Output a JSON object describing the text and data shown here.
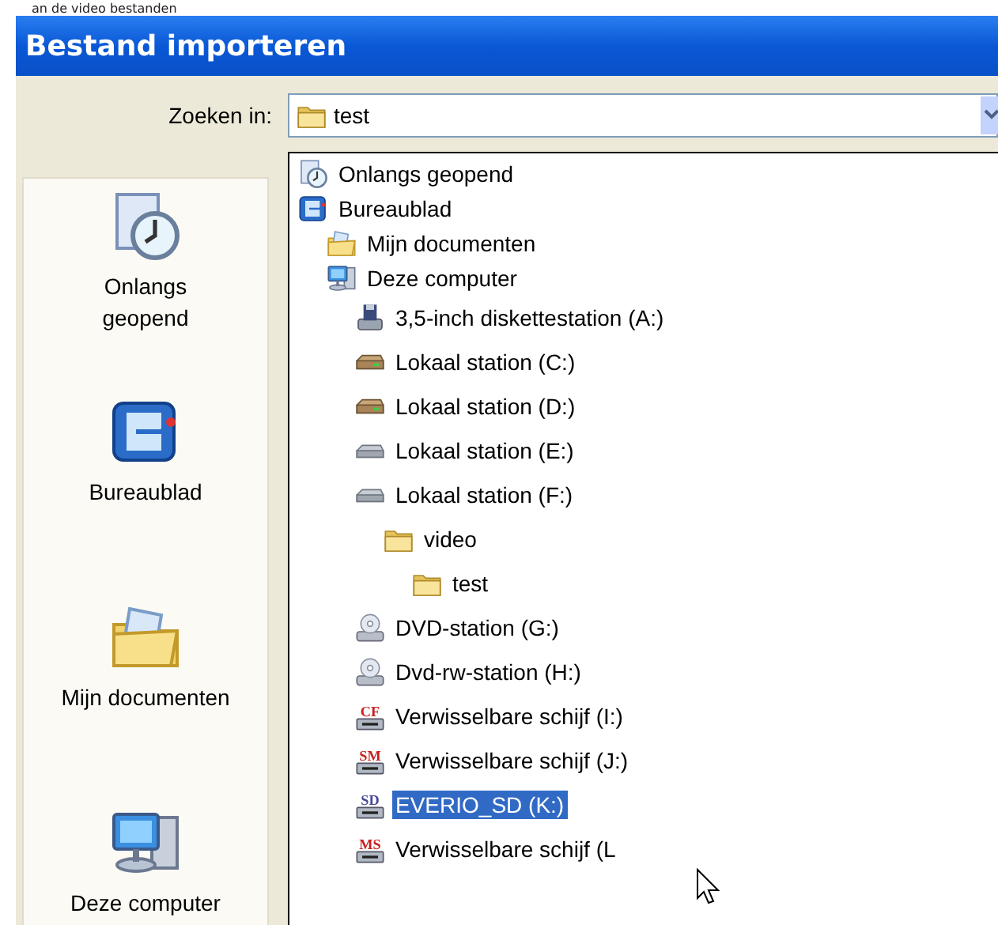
{
  "caption": "an de video bestanden",
  "window": {
    "title": "Bestand importeren"
  },
  "look_in": {
    "label": "Zoeken in:",
    "value": "test"
  },
  "places": [
    {
      "kind": "recent",
      "label": "Onlangs geopend"
    },
    {
      "kind": "desktop",
      "label": "Bureaublad"
    },
    {
      "kind": "documents",
      "label": "Mijn documenten"
    },
    {
      "kind": "computer",
      "label": "Deze computer"
    }
  ],
  "tree": [
    {
      "kind": "recent",
      "label": "Onlangs geopend",
      "selected": false
    },
    {
      "kind": "desktop",
      "label": "Bureaublad",
      "selected": false,
      "children": [
        {
          "kind": "documents",
          "label": "Mijn documenten",
          "selected": false
        },
        {
          "kind": "computer",
          "label": "Deze computer",
          "selected": false,
          "children": [
            {
              "kind": "floppy",
              "label": "3,5-inch diskettestation (A:)",
              "selected": false
            },
            {
              "kind": "hdd",
              "label": "Lokaal station (C:)",
              "selected": false
            },
            {
              "kind": "hdd",
              "label": "Lokaal station (D:)",
              "selected": false
            },
            {
              "kind": "disk",
              "label": "Lokaal station (E:)",
              "selected": false
            },
            {
              "kind": "disk",
              "label": "Lokaal station (F:)",
              "selected": false,
              "children": [
                {
                  "kind": "folder",
                  "label": "video",
                  "selected": false,
                  "children": [
                    {
                      "kind": "folder",
                      "label": "test",
                      "selected": false
                    }
                  ]
                }
              ]
            },
            {
              "kind": "dvd",
              "label": "DVD-station (G:)",
              "selected": false
            },
            {
              "kind": "dvd",
              "label": "Dvd-rw-station (H:)",
              "selected": false
            },
            {
              "kind": "card",
              "badge": "CF",
              "label": "Verwisselbare schijf (I:)",
              "selected": false
            },
            {
              "kind": "card",
              "badge": "SM",
              "label": "Verwisselbare schijf (J:)",
              "selected": false
            },
            {
              "kind": "card",
              "badge": "SD",
              "label": "EVERIO_SD (K:)",
              "selected": true
            },
            {
              "kind": "card",
              "badge": "MS",
              "label": "Verwisselbare schijf (L",
              "selected": false
            }
          ]
        }
      ]
    }
  ]
}
